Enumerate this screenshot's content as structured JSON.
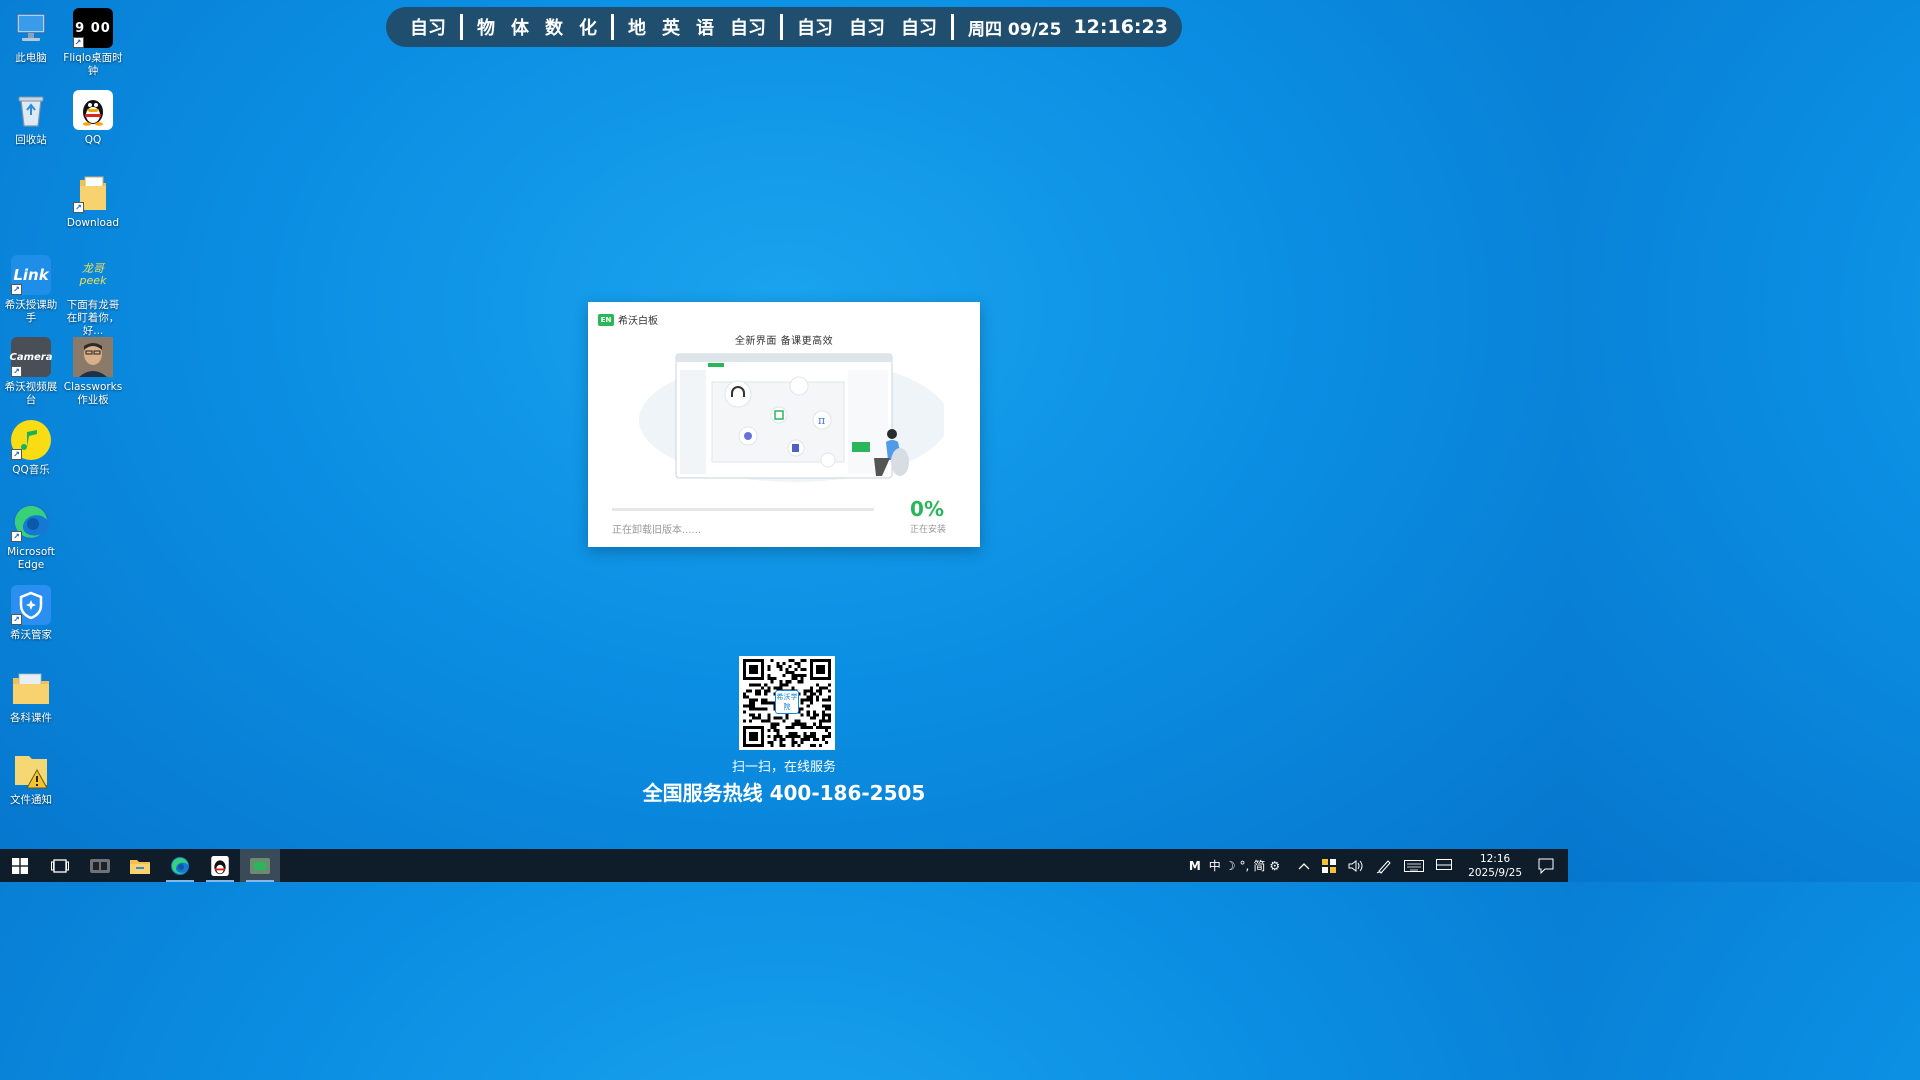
{
  "schedule": {
    "groups": [
      [
        "自习"
      ],
      [
        "物",
        "体",
        "数",
        "化"
      ],
      [
        "地",
        "英",
        "语",
        "自习"
      ],
      [
        "自习",
        "自习",
        "自习"
      ]
    ],
    "date": "周四 09/25",
    "time": "12:16:23"
  },
  "desktop": {
    "icons": [
      {
        "label": "此电脑",
        "icon": "this-pc-icon"
      },
      {
        "label": "Fliqlo桌面时钟",
        "icon": "fliqlo-clock-icon",
        "glyph": "9 00"
      },
      {
        "label": "回收站",
        "icon": "recycle-bin-icon"
      },
      {
        "label": "QQ",
        "icon": "qq-icon"
      },
      {
        "label": "Download",
        "icon": "folder-icon"
      },
      {
        "label": "希沃授课助手",
        "icon": "seewo-link-icon",
        "glyph": "Link"
      },
      {
        "label": "下面有龙哥在盯着你，好...",
        "icon": "longge-peek-icon",
        "glyph": "龙哥 peek"
      },
      {
        "label": "希沃视频展台",
        "icon": "seewo-camera-icon",
        "glyph": "Camera"
      },
      {
        "label": "Classworks作业板",
        "icon": "classworks-icon"
      },
      {
        "label": "QQ音乐",
        "icon": "qq-music-icon"
      },
      {
        "label": "Microsoft Edge",
        "icon": "edge-icon"
      },
      {
        "label": "希沃管家",
        "icon": "seewo-guard-icon"
      },
      {
        "label": "各科课件",
        "icon": "courseware-folder-icon"
      },
      {
        "label": "文件通知",
        "icon": "file-notice-icon"
      }
    ]
  },
  "installer": {
    "app_name": "希沃白板",
    "logo_text": "EN",
    "slogan": "全新界面  备课更高效",
    "progress": 0,
    "percent_text": "0%",
    "status_text": "正在卸载旧版本......",
    "percent_label": "正在安装",
    "accent": "#2bb65b"
  },
  "service": {
    "qr_center_text": "希沃学院",
    "caption": "扫一扫，在线服务",
    "hotline": "全国服务热线 400-186-2505"
  },
  "taskbar": {
    "apps": [
      "start-icon",
      "task-view-icon",
      "fliqlo-icon",
      "file-explorer-icon",
      "edge-icon",
      "qq-icon",
      "installer-icon"
    ],
    "ime_mode": "M",
    "ime_lang": "中",
    "ime_script": "简",
    "clock_time": "12:16",
    "clock_date": "2025/9/25"
  }
}
